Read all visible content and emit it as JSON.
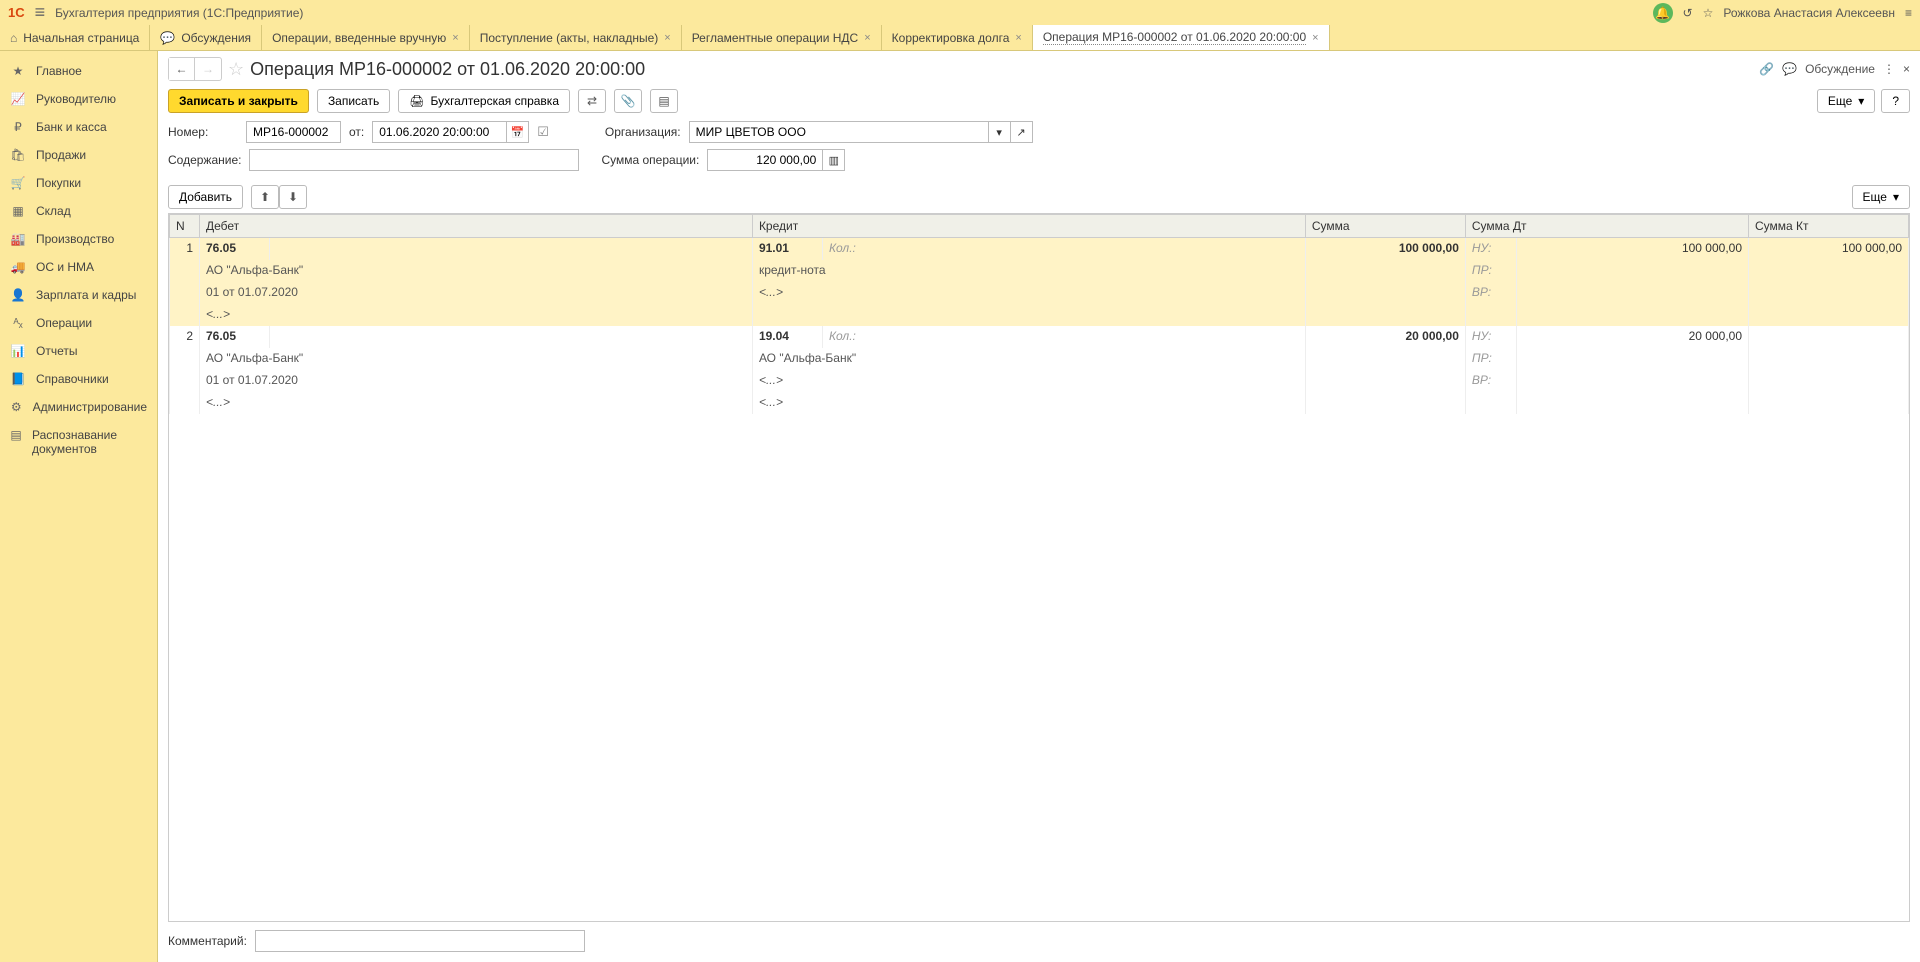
{
  "titlebar": {
    "logo": "1С",
    "title": "Бухгалтерия предприятия  (1С:Предприятие)",
    "user": "Рожкова Анастасия Алексеевн"
  },
  "tabs": {
    "home": "Начальная страница",
    "discuss": "Обсуждения",
    "items": [
      "Операции, введенные вручную",
      "Поступление (акты, накладные)",
      "Регламентные операции НДС",
      "Корректировка долга",
      "Операция МР16-000002 от 01.06.2020 20:00:00"
    ]
  },
  "sidebar": {
    "items": [
      "Главное",
      "Руководителю",
      "Банк и касса",
      "Продажи",
      "Покупки",
      "Склад",
      "Производство",
      "ОС и НМА",
      "Зарплата и кадры",
      "Операции",
      "Отчеты",
      "Справочники",
      "Администрирование",
      "Распознавание документов"
    ],
    "icons": [
      "★",
      "📈",
      "₽",
      "🛍",
      "🛒",
      "▦",
      "🏭",
      "🚚",
      "👤",
      "ᴬₓ",
      "📊",
      "📘",
      "⚙",
      "▤"
    ]
  },
  "page": {
    "title": "Операция МР16-000002 от 01.06.2020 20:00:00",
    "discuss": "Обсуждение"
  },
  "toolbar": {
    "save_close": "Записать и закрыть",
    "save": "Записать",
    "report": "Бухгалтерская справка",
    "more": "Еще",
    "help": "?"
  },
  "form": {
    "num_label": "Номер:",
    "num": "МР16-000002",
    "from": "от:",
    "date": "01.06.2020 20:00:00",
    "org_label": "Организация:",
    "org": "МИР ЦВЕТОВ ООО",
    "content_label": "Содержание:",
    "content": "",
    "sum_label": "Сумма операции:",
    "sum": "120 000,00",
    "comment_label": "Комментарий:",
    "comment": ""
  },
  "tbl_toolbar": {
    "add": "Добавить",
    "more": "Еще"
  },
  "columns": {
    "n": "N",
    "debit": "Дебет",
    "credit": "Кредит",
    "sum": "Сумма",
    "sum_dt": "Сумма Дт",
    "sum_kt": "Сумма Кт"
  },
  "acct_labels": {
    "nu": "НУ:",
    "pr": "ПР:",
    "vr": "ВР:",
    "kol": "Кол.:"
  },
  "placeholder": "<...>",
  "rows": [
    {
      "n": "1",
      "dt_account": "76.05",
      "dt_sub1": "АО \"Альфа-Банк\"",
      "dt_sub2": "01 от 01.07.2020",
      "dt_sub3": "<...>",
      "kt_account": "91.01",
      "kt_sub1": "кредит-нота",
      "kt_sub2": "<...>",
      "kt_sub3": "",
      "sum": "100 000,00",
      "nu_dt": "100 000,00",
      "nu_kt": "100 000,00",
      "selected": true
    },
    {
      "n": "2",
      "dt_account": "76.05",
      "dt_sub1": "АО \"Альфа-Банк\"",
      "dt_sub2": "01 от 01.07.2020",
      "dt_sub3": "<...>",
      "kt_account": "19.04",
      "kt_sub1": "АО \"Альфа-Банк\"",
      "kt_sub2": "<...>",
      "kt_sub3": "<...>",
      "sum": "20 000,00",
      "nu_dt": "20 000,00",
      "nu_kt": "",
      "selected": false
    }
  ]
}
